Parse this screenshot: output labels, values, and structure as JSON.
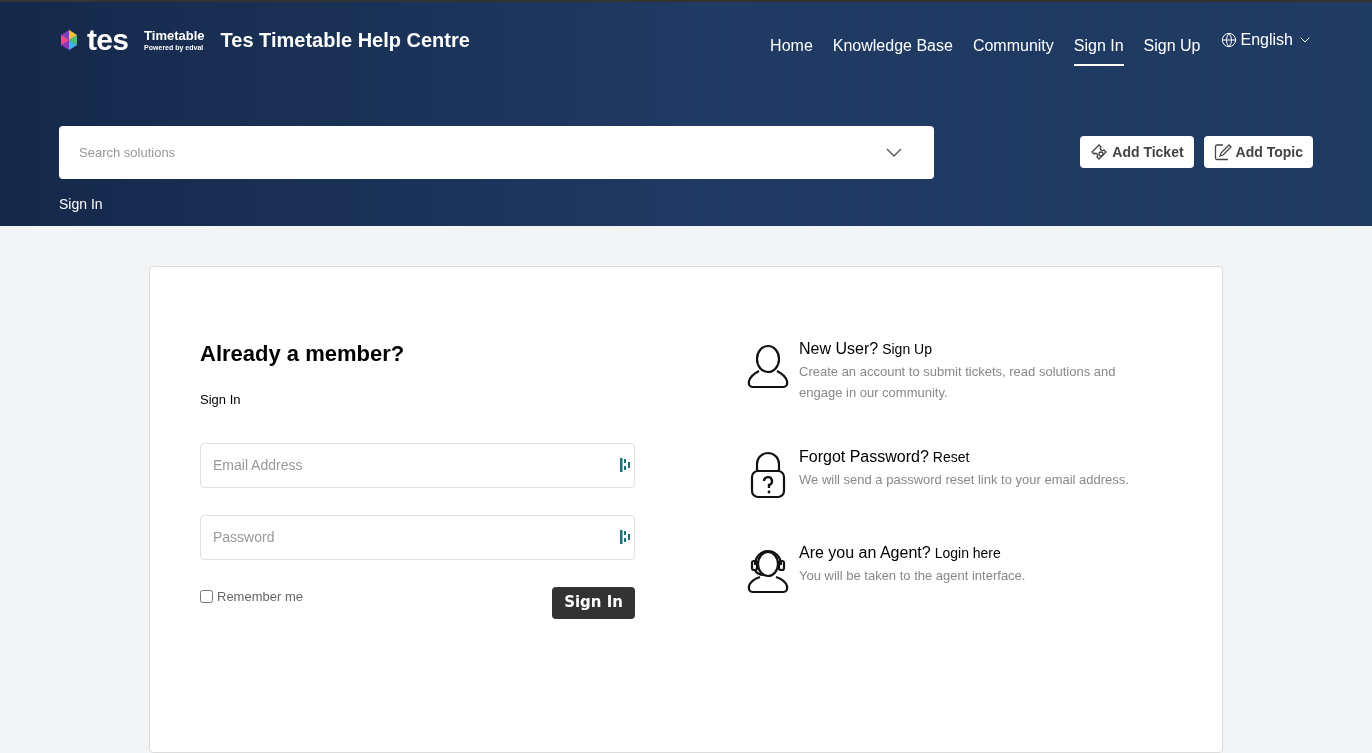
{
  "brand": {
    "logo_text": "tes",
    "product": "Timetable",
    "tagline": "Powered by edval",
    "site_title": "Tes Timetable Help Centre"
  },
  "nav": [
    {
      "label": "Home",
      "selected": false
    },
    {
      "label": "Knowledge Base",
      "selected": false
    },
    {
      "label": "Community",
      "selected": false
    },
    {
      "label": "Sign In",
      "selected": true
    },
    {
      "label": "Sign Up",
      "selected": false
    }
  ],
  "language": "English",
  "search": {
    "placeholder": "Search solutions"
  },
  "actions": [
    {
      "label": "Add Ticket",
      "kind": "ticket"
    },
    {
      "label": "Add Topic",
      "kind": "topic"
    }
  ],
  "breadcrumb": "Sign In",
  "login": {
    "heading": "Already a member?",
    "subheading": "Sign In",
    "email_placeholder": "Email Address",
    "password_placeholder": "Password",
    "remember": {
      "label": "Remember me",
      "checked": false
    },
    "submit": "Sign In"
  },
  "help": [
    {
      "kind": "user",
      "title": "New User?",
      "link": "Sign Up",
      "text": "Create an account to submit tickets, read solutions and engage in our community."
    },
    {
      "kind": "lock",
      "title": "Forgot Password?",
      "link": "Reset",
      "text": "We will send a password reset link to your email address."
    },
    {
      "kind": "agent",
      "title": "Are you an Agent?",
      "link": "Login here",
      "text": "You will be taken to the agent interface."
    }
  ]
}
